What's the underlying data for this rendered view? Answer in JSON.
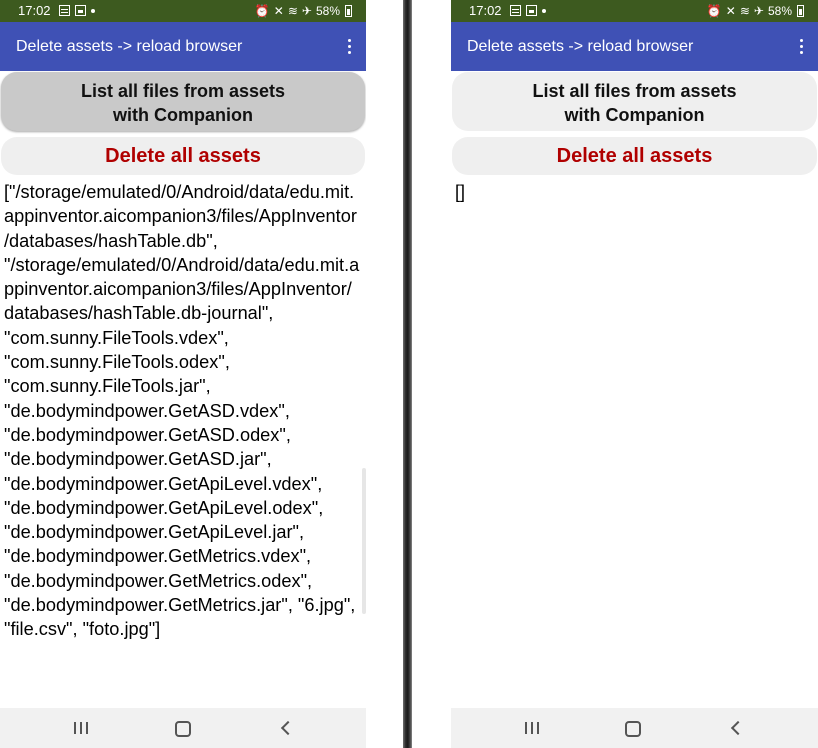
{
  "colors": {
    "status_bar": "#3d5a1f",
    "app_bar": "#3f51b5",
    "delete_text": "#b00000"
  },
  "phones": [
    {
      "status": {
        "time": "17:02",
        "battery": "58%"
      },
      "app_bar": {
        "title": "Delete assets  ->  reload browser",
        "menu_icon": "overflow-menu-icon"
      },
      "list_button": {
        "label": "List all files from assets\nwith Companion",
        "state": "pressed"
      },
      "delete_button": {
        "label": "Delete all assets"
      },
      "result_text": "[\"/storage/emulated/0/Android/data/edu.mit.appinventor.aicompanion3/files/AppInventor/databases/hashTable.db\", \"/storage/emulated/0/Android/data/edu.mit.appinventor.aicompanion3/files/AppInventor/databases/hashTable.db-journal\", \"com.sunny.FileTools.vdex\", \"com.sunny.FileTools.odex\", \"com.sunny.FileTools.jar\", \"de.bodymindpower.GetASD.vdex\", \"de.bodymindpower.GetASD.odex\", \"de.bodymindpower.GetASD.jar\", \"de.bodymindpower.GetApiLevel.vdex\", \"de.bodymindpower.GetApiLevel.odex\", \"de.bodymindpower.GetApiLevel.jar\", \"de.bodymindpower.GetMetrics.vdex\", \"de.bodymindpower.GetMetrics.odex\", \"de.bodymindpower.GetMetrics.jar\", \"6.jpg\", \"file.csv\", \"foto.jpg\"]",
      "nav": [
        "recent-apps-icon",
        "home-icon",
        "back-icon"
      ]
    },
    {
      "status": {
        "time": "17:02",
        "battery": "58%"
      },
      "app_bar": {
        "title": "Delete assets  ->  reload browser",
        "menu_icon": "overflow-menu-icon"
      },
      "list_button": {
        "label": "List all files from assets\nwith Companion",
        "state": "normal"
      },
      "delete_button": {
        "label": "Delete all assets"
      },
      "result_text": "[]",
      "nav": [
        "recent-apps-icon",
        "home-icon",
        "back-icon"
      ]
    }
  ]
}
